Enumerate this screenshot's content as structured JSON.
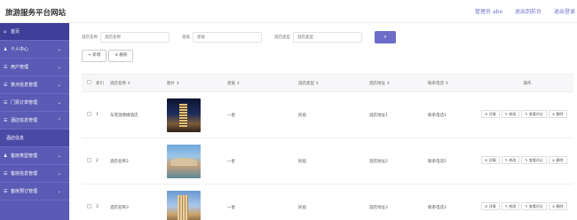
{
  "header": {
    "title": "旅游服务平台网站",
    "user": "管理员 abo",
    "back_home": "退出到前台",
    "logout": "退出登录"
  },
  "sidebar": {
    "items": [
      {
        "icon": "home-icon",
        "glyph": "⌂",
        "label": "首页",
        "arrow": ""
      },
      {
        "icon": "user-icon",
        "glyph": "♟",
        "label": "个人中心",
        "arrow": "⌄"
      },
      {
        "icon": "list-icon",
        "glyph": "☰",
        "label": "用户管理",
        "arrow": "⌄"
      },
      {
        "icon": "list-icon",
        "glyph": "☰",
        "label": "景点信息管理",
        "arrow": "⌄"
      },
      {
        "icon": "list-icon",
        "glyph": "☰",
        "label": "门票订单管理",
        "arrow": "⌄"
      },
      {
        "icon": "list-icon",
        "glyph": "☰",
        "label": "酒店信息管理",
        "arrow": "⌃"
      },
      {
        "icon": "",
        "glyph": "",
        "label": "酒店信息",
        "arrow": ""
      },
      {
        "icon": "user-icon",
        "glyph": "♟",
        "label": "客房类型管理",
        "arrow": "⌄"
      },
      {
        "icon": "list-icon",
        "glyph": "☰",
        "label": "客房信息管理",
        "arrow": "⌄"
      },
      {
        "icon": "list-icon",
        "glyph": "☰",
        "label": "客房预订管理",
        "arrow": "⌄"
      }
    ]
  },
  "search": {
    "fields": [
      {
        "label": "酒店名称",
        "placeholder": "酒店名称"
      },
      {
        "label": "星级",
        "placeholder": "星级"
      },
      {
        "label": "酒店类型",
        "placeholder": "酒店类型"
      }
    ],
    "button_glyph": "⌕"
  },
  "toolbar": {
    "add": "+ 新增",
    "delete": "⊘ 删除"
  },
  "table": {
    "columns": [
      "索引",
      "酒店名称 ⇕",
      "图片 ⇕",
      "星级 ⇕",
      "酒店类型 ⇕",
      "酒店地址 ⇕",
      "联系电话 ⇕",
      "操作"
    ],
    "rows": [
      {
        "index": "1",
        "name": "东莞温德姆酒店",
        "star": "一星",
        "type": "民宿",
        "address": "酒店地址1",
        "phone": "联系电话1"
      },
      {
        "index": "2",
        "name": "酒店名称2",
        "star": "一星",
        "type": "民宿",
        "address": "酒店地址2",
        "phone": "联系电话2"
      },
      {
        "index": "3",
        "name": "酒店名称3",
        "star": "一星",
        "type": "民宿",
        "address": "酒店地址3",
        "phone": "联系电话3"
      }
    ],
    "actions": {
      "detail": "⊟ 详情",
      "edit": "✎ 修改",
      "review": "✎ 查看评论",
      "delete": "⊘ 删除"
    }
  }
}
